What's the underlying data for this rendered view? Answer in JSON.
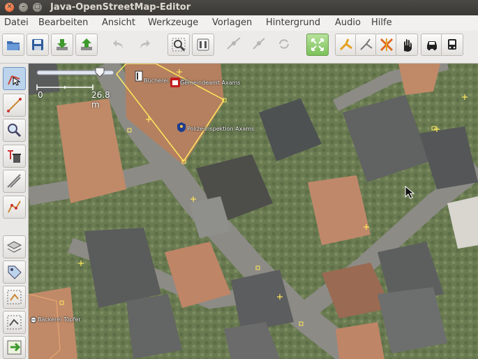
{
  "window": {
    "title": "Java-OpenStreetMap-Editor"
  },
  "menu": [
    "Datei",
    "Bearbeiten",
    "Ansicht",
    "Werkzeuge",
    "Vorlagen",
    "Hintergrund",
    "Audio",
    "Hilfe"
  ],
  "map": {
    "scale": {
      "zero": "0",
      "distance": "26.8 m"
    },
    "labels": {
      "library": "Bücherei Axams",
      "townhall": "Gemeindeamt Axams",
      "police": "Polizeiinspektion Axams",
      "bakery": "Bäckerei Töpfer"
    }
  },
  "icons": {
    "toolbar": [
      "open-file-icon",
      "save-icon",
      "download-icon",
      "upload-icon",
      "undo-icon",
      "redo-icon",
      "zoom-to-data-icon",
      "preferences-icon",
      "split-way-icon",
      "combine-way-icon",
      "reverse-way-icon",
      "wireframe-toggle-icon",
      "road-preset-icon",
      "path-preset-icon",
      "crossing-preset-icon",
      "barrier-preset-icon",
      "car-preset-icon",
      "bus-preset-icon"
    ],
    "left": [
      "select-tool-icon",
      "draw-tool-icon",
      "zoom-tool-icon",
      "delete-tool-icon",
      "parallel-tool-icon",
      "improve-way-icon",
      "layers-icon",
      "tags-icon",
      "selection-icon",
      "relation-icon",
      "conflict-icon"
    ]
  },
  "colors": {
    "selection": "#ffe85c",
    "titlebar": "#3c3b37"
  }
}
